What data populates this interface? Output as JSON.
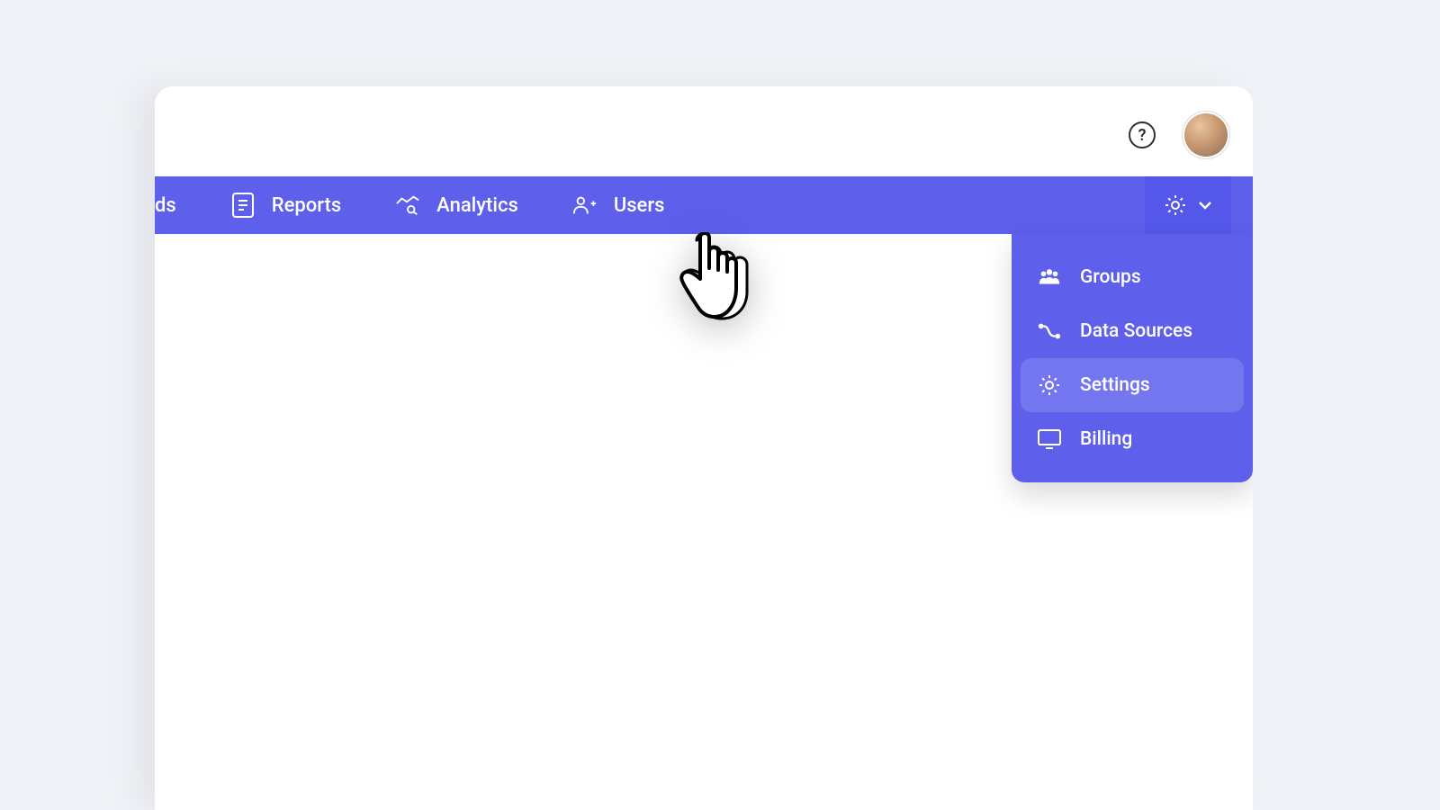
{
  "colors": {
    "primary": "#5e60ec",
    "primary_hover": "#7476f0",
    "background": "#f0f2f7"
  },
  "topbar": {
    "help_tooltip": "?"
  },
  "nav": {
    "items": [
      {
        "label": "ds",
        "icon": "dashboards-icon",
        "partial": true
      },
      {
        "label": "Reports",
        "icon": "reports-icon",
        "partial": false
      },
      {
        "label": "Analytics",
        "icon": "analytics-icon",
        "partial": false
      },
      {
        "label": "Users",
        "icon": "users-icon",
        "partial": false
      }
    ]
  },
  "settings_menu": {
    "items": [
      {
        "label": "Groups",
        "icon": "groups-icon",
        "highlighted": false
      },
      {
        "label": "Data Sources",
        "icon": "data-sources-icon",
        "highlighted": false
      },
      {
        "label": "Settings",
        "icon": "settings-icon",
        "highlighted": true
      },
      {
        "label": "Billing",
        "icon": "billing-icon",
        "highlighted": false
      }
    ]
  }
}
